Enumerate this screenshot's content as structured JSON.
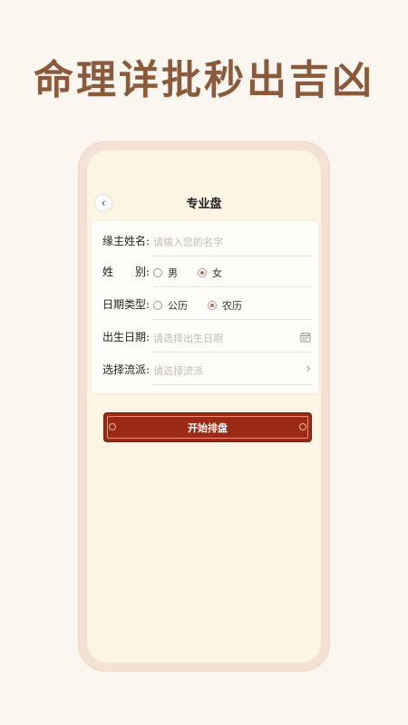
{
  "promo": {
    "headline": "命理详批秒出吉凶"
  },
  "header": {
    "title": "专业盘",
    "back_icon": "chevron-left-icon"
  },
  "form": {
    "name": {
      "label": "缘主姓名:",
      "placeholder": "请输入您的名字"
    },
    "gender": {
      "label": "姓　　别:",
      "options": [
        {
          "label": "男",
          "selected": false
        },
        {
          "label": "女",
          "selected": true
        }
      ]
    },
    "date_type": {
      "label": "日期类型:",
      "options": [
        {
          "label": "公历",
          "selected": false
        },
        {
          "label": "农历",
          "selected": true
        }
      ]
    },
    "birth_date": {
      "label": "出生日期:",
      "placeholder": "请选择出生日期",
      "icon": "calendar-icon"
    },
    "school": {
      "label": "选择流派:",
      "placeholder": "请选择流派",
      "icon": "chevron-right-icon"
    }
  },
  "actions": {
    "start_label": "开始排盘"
  },
  "colors": {
    "page_bg": "#fbf6f0",
    "headline": "#8a5a3b",
    "phone_frame": "#f3e2d4",
    "screen_bg": "#fdf5e4",
    "primary_button": "#9a2a14",
    "radio_selected": "#b06a5e"
  }
}
